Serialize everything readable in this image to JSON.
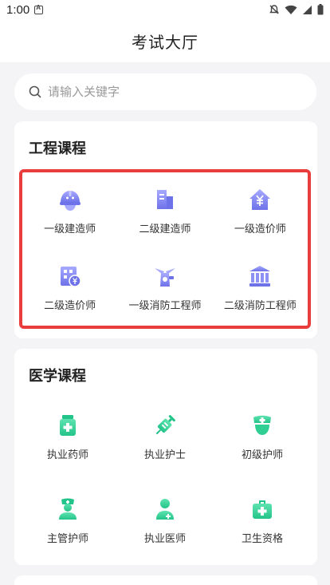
{
  "status_bar": {
    "time": "1:00"
  },
  "header": {
    "title": "考试大厅"
  },
  "search": {
    "placeholder": "请输入关键字"
  },
  "engineering": {
    "title": "工程课程",
    "items": [
      {
        "label": "一级建造师",
        "icon": "helmet-icon"
      },
      {
        "label": "二级建造师",
        "icon": "document-icon"
      },
      {
        "label": "一级造价师",
        "icon": "house-yen-icon"
      },
      {
        "label": "二级造价师",
        "icon": "building-yen-icon"
      },
      {
        "label": "一级消防工程师",
        "icon": "fire-hydrant-icon"
      },
      {
        "label": "二级消防工程师",
        "icon": "bank-icon"
      }
    ]
  },
  "medical": {
    "title": "医学课程",
    "items": [
      {
        "label": "执业药师",
        "icon": "medicine-bottle-icon"
      },
      {
        "label": "执业护士",
        "icon": "syringe-icon"
      },
      {
        "label": "初级护师",
        "icon": "nurse-cap-icon"
      },
      {
        "label": "主管护师",
        "icon": "nurse-icon"
      },
      {
        "label": "执业医师",
        "icon": "doctor-icon"
      },
      {
        "label": "卫生资格",
        "icon": "medical-kit-icon"
      }
    ]
  },
  "colors": {
    "engineering_icon": "#7b7ff0",
    "medical_icon": "#2fcf94",
    "highlight_border": "#e93c3c"
  }
}
